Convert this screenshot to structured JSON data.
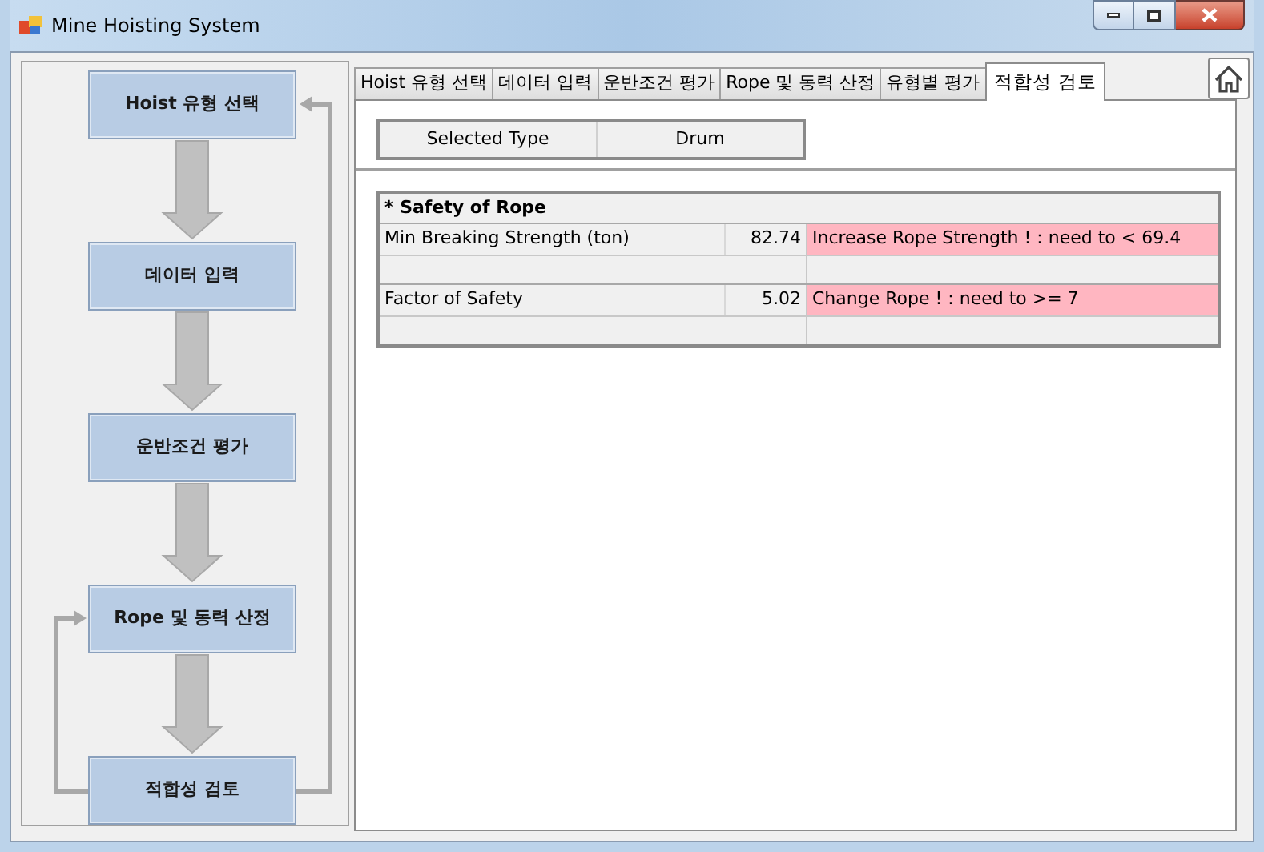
{
  "window": {
    "title": "Mine Hoisting System"
  },
  "flow": {
    "steps": [
      {
        "label": "Hoist 유형 선택"
      },
      {
        "label": "데이터 입력"
      },
      {
        "label": "운반조건 평가"
      },
      {
        "label": "Rope 및 동력 산정"
      },
      {
        "label": "적합성 검토"
      }
    ]
  },
  "tabs": [
    {
      "label": "Hoist 유형 선택",
      "selected": false
    },
    {
      "label": "데이터 입력",
      "selected": false
    },
    {
      "label": "운반조건 평가",
      "selected": false
    },
    {
      "label": "Rope 및 동력 산정",
      "selected": false
    },
    {
      "label": "유형별 평가",
      "selected": false
    },
    {
      "label": "적합성 검토",
      "selected": true
    }
  ],
  "selected_type": {
    "label": "Selected Type",
    "value": "Drum"
  },
  "safety_table": {
    "title": "* Safety of Rope",
    "rows": [
      {
        "label": "Min Breaking Strength (ton)",
        "value": "82.74",
        "message": "Increase Rope Strength ! : need to < 69.4",
        "alert": true
      },
      {
        "label": "Factor of Safety",
        "value": "5.02",
        "message": "Change Rope ! : need to >= 7",
        "alert": true
      }
    ]
  }
}
